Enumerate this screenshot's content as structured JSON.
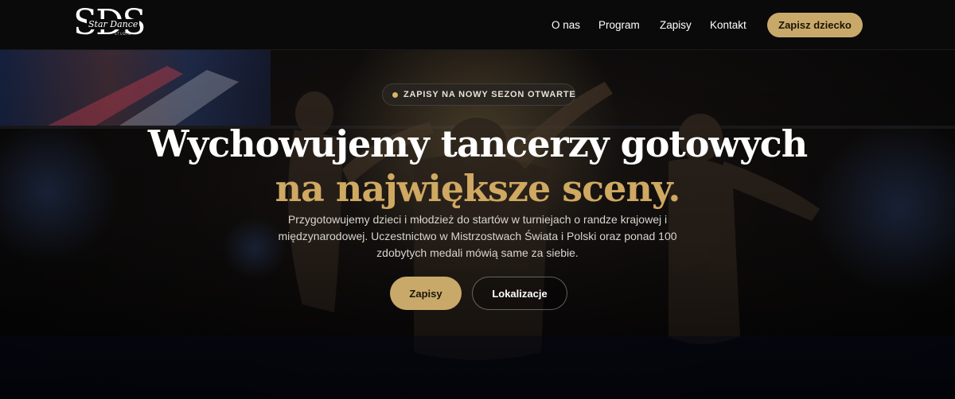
{
  "header": {
    "logo": {
      "monogram": "SDS",
      "script": "Star Dance",
      "small": "STUDIO"
    },
    "nav": [
      {
        "label": "O nas"
      },
      {
        "label": "Program"
      },
      {
        "label": "Zapisy"
      },
      {
        "label": "Kontakt"
      }
    ],
    "cta_label": "Zapisz dziecko"
  },
  "hero": {
    "badge": "ZAPISY NA NOWY SEZON OTWARTE",
    "headline_line1": "Wychowujemy tancerzy gotowych",
    "headline_line2": "na największe sceny.",
    "lead": "Przygotowujemy dzieci i młodzież do startów w turniejach o randze krajowej i międzynarodowej. Uczestnictwo w Mistrzostwach Świata i Polski oraz ponad 100 zdobytych medali mówią same za siebie.",
    "primary_button": "Zapisy",
    "secondary_button": "Lokalizacje"
  },
  "colors": {
    "accent": "#c9a96a",
    "headline_accent": "#cfa862",
    "header_bg": "#0a0a0b"
  }
}
